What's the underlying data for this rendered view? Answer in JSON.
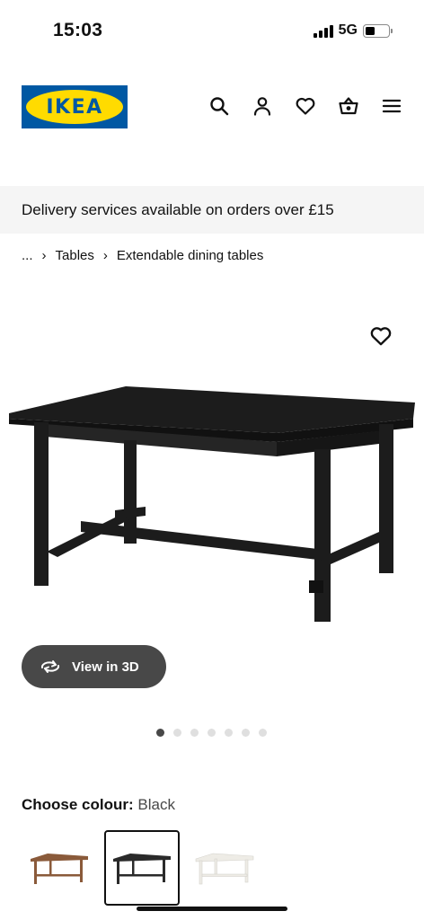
{
  "status_bar": {
    "time": "15:03",
    "network": "5G",
    "battery_level": 0.3
  },
  "header": {
    "logo_text": "IKEA",
    "icons": [
      "search-icon",
      "account-icon",
      "heart-icon",
      "basket-icon",
      "menu-icon"
    ]
  },
  "banner": {
    "text": "Delivery services available on orders over £15"
  },
  "breadcrumb": {
    "items": [
      "...",
      "Tables",
      "Extendable dining tables"
    ]
  },
  "gallery": {
    "view3d_label": "View in 3D",
    "image_count": 7,
    "active_index": 0
  },
  "colour": {
    "label": "Choose colour:",
    "value": "Black",
    "options": [
      {
        "name": "Brown",
        "hex": "#8a5a3a"
      },
      {
        "name": "Black",
        "hex": "#2a2a2a",
        "selected": true
      },
      {
        "name": "White",
        "hex": "#f0eee8"
      }
    ]
  },
  "colors": {
    "ikea_blue": "#0058a3",
    "ikea_yellow": "#ffdb00",
    "pill_bg": "#484848",
    "banner_bg": "#f5f5f5"
  }
}
